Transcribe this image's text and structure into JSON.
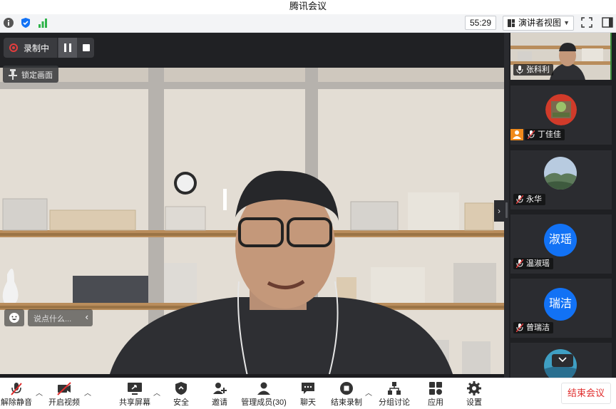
{
  "app": {
    "title": "腾讯会议"
  },
  "topbar": {
    "timer": "55:29",
    "view_button": "演讲者视图",
    "icons": [
      "info-icon",
      "shield-icon",
      "signal-icon",
      "fullscreen-icon",
      "sidebar-toggle-icon"
    ]
  },
  "main": {
    "record_label": "录制中",
    "lock_label": "锁定画面",
    "chat_placeholder": "说点什么...",
    "chat_caret": "‹",
    "next_arrow": "›"
  },
  "participants": [
    {
      "name": "张科利",
      "type": "video",
      "muted": true
    },
    {
      "name": "丁佳佳",
      "type": "avatar-image",
      "muted": true,
      "host": true
    },
    {
      "name": "永华",
      "type": "avatar-image",
      "muted": true
    },
    {
      "name": "温淑瑶",
      "type": "avatar-text",
      "avatar_text": "淑瑶",
      "muted": true
    },
    {
      "name": "曾瑞洁",
      "type": "avatar-text",
      "avatar_text": "瑞洁",
      "muted": true
    },
    {
      "name": "",
      "type": "avatar-image",
      "muted": false
    }
  ],
  "toolbar": {
    "unmute": "解除静音",
    "video": "开启视频",
    "share": "共享屏幕",
    "security": "安全",
    "invite": "邀请",
    "members": "管理成员(30)",
    "chat": "聊天",
    "end_record": "结束录制",
    "breakout": "分组讨论",
    "apps": "应用",
    "settings": "设置",
    "end_meeting": "结束会议"
  },
  "colors": {
    "accent_blue": "#1272f5",
    "danger_red": "#e02c2c",
    "record_red": "#e43d3d",
    "host_orange": "#f08a1c"
  }
}
